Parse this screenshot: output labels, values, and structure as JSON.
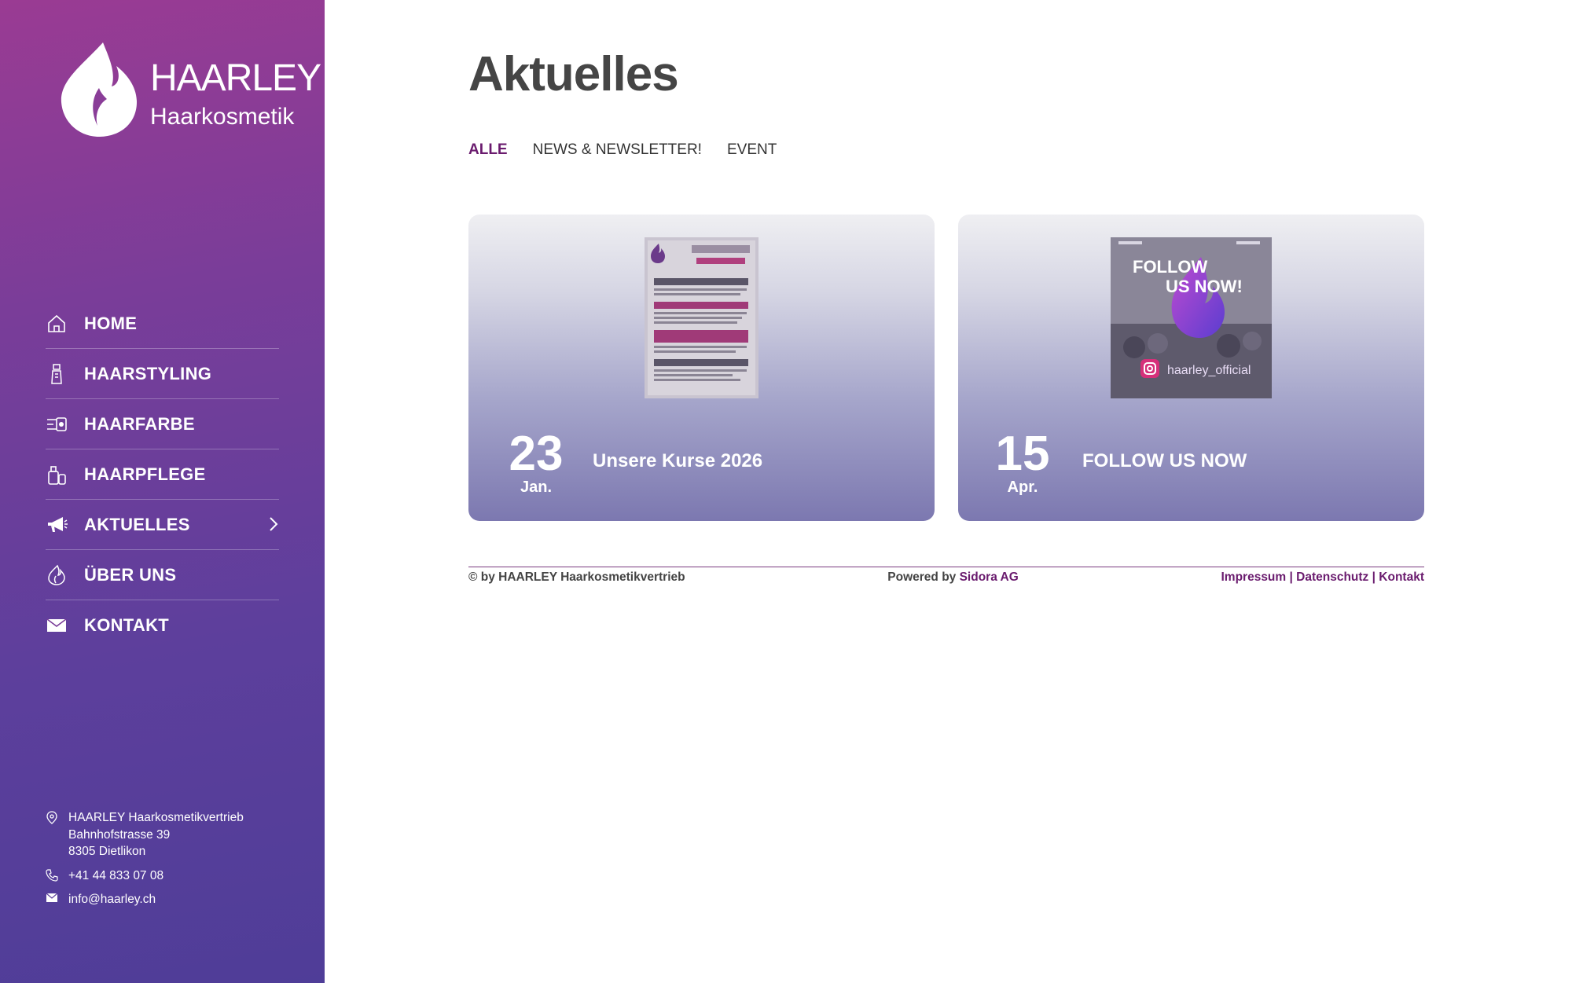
{
  "brand": {
    "name": "HAARLEY",
    "subtitle": "Haarkosmetik"
  },
  "sidebar": {
    "nav": [
      {
        "label": "HOME",
        "icon": "home-icon"
      },
      {
        "label": "HAARSTYLING",
        "icon": "styling-icon"
      },
      {
        "label": "HAARFARBE",
        "icon": "color-icon"
      },
      {
        "label": "HAARPFLEGE",
        "icon": "care-icon"
      },
      {
        "label": "AKTUELLES",
        "icon": "megaphone-icon",
        "has_submenu": true
      },
      {
        "label": "ÜBER UNS",
        "icon": "flame-icon"
      },
      {
        "label": "KONTAKT",
        "icon": "mail-icon"
      }
    ],
    "contact": {
      "company": "HAARLEY Haarkosmetikvertrieb",
      "street": "Bahnhofstrasse 39",
      "city": "8305 Dietlikon",
      "phone": "+41 44 833 07 08",
      "email": "info@haarley.ch"
    }
  },
  "main": {
    "title": "Aktuelles",
    "filters": [
      {
        "label": "ALLE",
        "active": true
      },
      {
        "label": "NEWS & NEWSLETTER!",
        "active": false
      },
      {
        "label": "EVENT",
        "active": false
      }
    ],
    "posts": [
      {
        "day": "23",
        "month": "Jan.",
        "title": "Unsere Kurse 2026",
        "image": "BioAcademy Kalender 2026 flyer"
      },
      {
        "day": "15",
        "month": "Apr.",
        "title": "FOLLOW US NOW",
        "image": "Follow us now haarley_official instagram"
      }
    ]
  },
  "footer": {
    "copyright": "© by HAARLEY Haarkosmetikvertrieb",
    "powered_prefix": "Powered by",
    "powered_link": "Sidora AG",
    "links": [
      "Impressum",
      "Datenschutz",
      "Kontakt"
    ],
    "separator": "|"
  },
  "colors": {
    "sidebar_top": "#9a3b93",
    "sidebar_bottom": "#4f3d98",
    "accent": "#6a1b6e",
    "title": "#454545"
  }
}
